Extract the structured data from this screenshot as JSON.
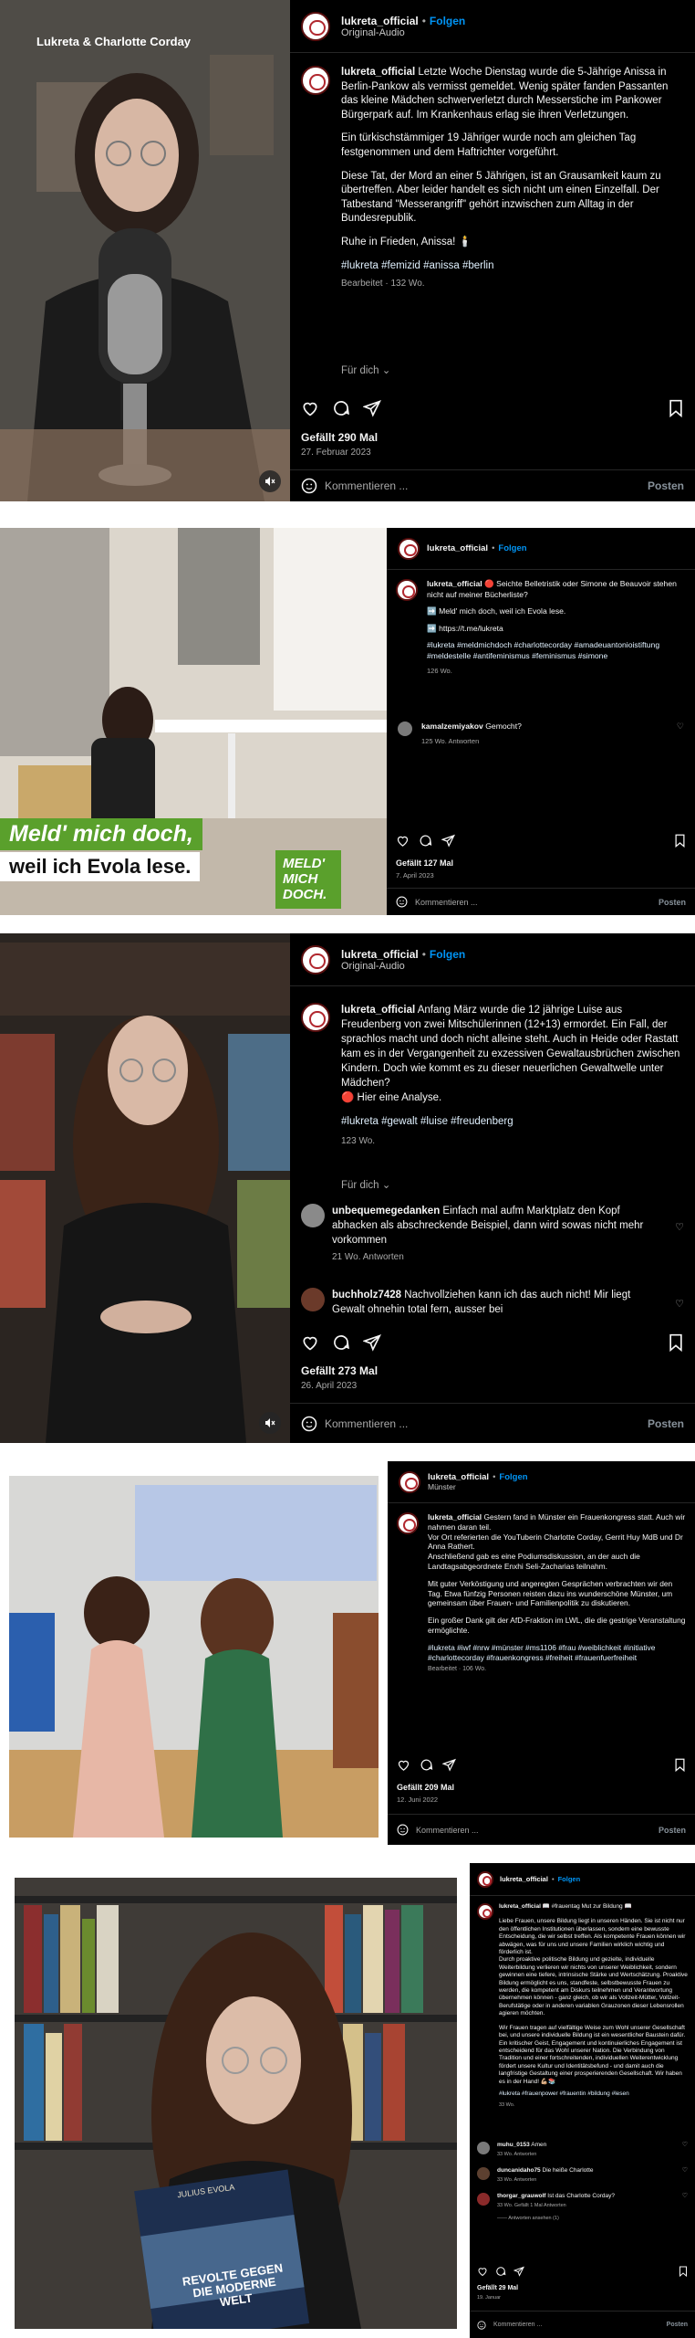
{
  "icons": {
    "heart": "heart-icon",
    "comment": "comment-icon",
    "share": "share-icon",
    "save": "bookmark-icon",
    "emoji": "emoji-icon",
    "mute": "mute-icon"
  },
  "colors": {
    "accent": "#0095f6",
    "panel": "#000000",
    "hashtag": "#e0f1ff",
    "muted": "#a8a8a8",
    "green": "#5aa02c"
  },
  "posts": [
    {
      "username": "lukreta_official",
      "sep": "•",
      "follow": "Folgen",
      "subtitle": "Original-Audio",
      "media_overlay": "Lukreta & Charlotte Corday",
      "caption_user": "lukreta_official",
      "caption_p1": "Letzte Woche Dienstag wurde die 5-Jährige Anissa in Berlin-Pankow als vermisst gemeldet. Wenig später fanden Passanten das kleine Mädchen schwerverletzt durch Messerstiche im Pankower Bürgerpark auf. Im Krankenhaus erlag sie ihren Verletzungen.",
      "caption_p2": "Ein türkischstämmiger 19 Jähriger wurde noch am gleichen Tag festgenommen und dem Haftrichter vorgeführt.",
      "caption_p3": "Diese Tat, der Mord an einer 5 Jährigen, ist an Grausamkeit kaum zu übertreffen. Aber leider handelt es sich nicht um einen Einzelfall. Der Tatbestand \"Messerangriff\" gehört inzwischen zum Alltag in der Bundesrepublik.",
      "caption_p4": "Ruhe in Frieden, Anissa! 🕯️",
      "hashtags": "#lukreta #femizid #anissa #berlin",
      "edited": "Bearbeitet · 132 Wo.",
      "for_you": "Für dich ⌄",
      "likes": "Gefällt 290 Mal",
      "date": "27. Februar 2023",
      "comment_placeholder": "Kommentieren ...",
      "post_button": "Posten"
    },
    {
      "username": "lukreta_official",
      "sep": "•",
      "follow": "Folgen",
      "caption_user": "lukreta_official",
      "caption_text": "🔴 Seichte Belletristik oder Simone de Beauvoir stehen nicht auf meiner Bücherliste?",
      "line2": "➡️ Meld' mich doch, weil ich Evola lese.",
      "line3": "➡️ https://t.me/lukreta",
      "hashtags": "#lukreta #meldmichdoch #charlottecorday #amadeuantonioistiftung #meldestelle #antifeminismus #feminismus #simone",
      "time": "126 Wo.",
      "c1_user": "kamalzemiyakov",
      "c1_text": "Gemocht?",
      "c1_meta": "125 Wo.   Antworten",
      "banner1": "Meld' mich doch,",
      "banner2": "weil ich Evola lese.",
      "logo1": "MELD'",
      "logo2": "MICH",
      "logo3": "DOCH.",
      "likes": "Gefällt 127 Mal",
      "date": "7. April 2023",
      "comment_placeholder": "Kommentieren ...",
      "post_button": "Posten"
    },
    {
      "username": "lukreta_official",
      "sep": "•",
      "follow": "Folgen",
      "subtitle": "Original-Audio",
      "caption_user": "lukreta_official",
      "caption_text": "Anfang März wurde die 12 jährige Luise aus Freudenberg von zwei Mitschülerinnen (12+13) ermordet. Ein Fall, der sprachlos macht und doch nicht alleine steht. Auch in Heide oder Rastatt kam es in der Vergangenheit zu exzessiven Gewaltausbrüchen zwischen Kindern. Doch wie kommt es zu dieser neuerlichen Gewaltwelle unter Mädchen?",
      "caption_line": "🔴 Hier eine Analyse.",
      "hashtags": "#lukreta #gewalt #luise #freudenberg",
      "time": "123 Wo.",
      "for_you": "Für dich ⌄",
      "c1_user": "unbequemegedanken",
      "c1_text": "Einfach mal aufm Marktplatz den Kopf abhacken als abschreckende Beispiel, dann wird sowas nicht mehr vorkommen",
      "c1_meta": "21 Wo.   Antworten",
      "c2_user": "buchholz7428",
      "c2_text": "Nachvollziehen kann ich das auch nicht! Mir liegt Gewalt ohnehin total fern, ausser bei",
      "likes": "Gefällt 273 Mal",
      "date": "26. April 2023",
      "comment_placeholder": "Kommentieren ...",
      "post_button": "Posten"
    },
    {
      "username": "lukreta_official",
      "sep": "•",
      "follow": "Folgen",
      "subtitle": "Münster",
      "caption_user": "lukreta_official",
      "caption_p1": "Gestern fand in Münster ein Frauenkongress statt. Auch wir nahmen daran teil.",
      "caption_p2": "Vor Ort referierten die YouTuberin Charlotte Corday, Gerrit Huy MdB und Dr Anna Rathert.",
      "caption_p3": "Anschließend gab es eine Podiumsdiskussion, an der auch die Landtagsabgeordnete Enxhi Seli-Zacharias teilnahm.",
      "caption_p4": "Mit guter Verköstigung und angeregten Gesprächen verbrachten wir den Tag. Etwa fünfzig Personen reisten dazu ins wunderschöne Münster, um gemeinsam über Frauen- und Familienpolitik zu diskutieren.",
      "caption_p5": "Ein großer Dank gilt der AfD-Fraktion im LWL, die die gestrige Veranstaltung ermöglichte.",
      "hashtags": "#lukreta #iwf #nrw #münster #ms1106 #frau #weiblichkeit #initiative #charlottecorday #frauenkongress #freiheit #frauenfuerfreiheit",
      "edited": "Bearbeitet · 106 Wo.",
      "likes": "Gefällt 209 Mal",
      "date": "12. Juni 2022",
      "comment_placeholder": "Kommentieren ...",
      "post_button": "Posten"
    },
    {
      "username": "lukreta_official",
      "sep": "•",
      "follow": "Folgen",
      "caption_user": "lukreta_official",
      "caption_head": "📖 #frauentag Mut zur Bildung 📖",
      "caption_p1": "Liebe Frauen, unsere Bildung liegt in unseren Händen. Sie ist nicht nur den öffentlichen Institutionen überlassen, sondern eine bewusste Entscheidung, die wir selbst treffen. Als kompetente Frauen können wir abwägen, was für uns und unsere Familien wirklich wichtig und förderlich ist.",
      "caption_p2": "Durch proaktive politische Bildung und gezielte, individuelle Weiterbildung verlieren wir nichts von unserer Weiblichkeit, sondern gewinnen eine tiefere, intrinsische Stärke und Wertschätzung. Proaktive Bildung ermöglicht es uns, standfeste, selbstbewusste Frauen zu werden, die kompetent am Diskurs teilnehmen und Verantwortung übernehmen können - ganz gleich, ob wir als Vollzeit-Mütter, Vollzeit-Berufstätige oder in anderen variablen Grauzonen dieser Lebensrollen agieren möchten.",
      "caption_p3": "Wir Frauen tragen auf vielfältige Weise zum Wohl unserer Gesellschaft bei, und unsere individuelle Bildung ist ein wesentlicher Baustein dafür. Ein kritischer Geist, Engagement und kontinuierliches Engagement ist entscheidend für das Wohl unserer Nation. Die Verbindung von Tradition und einer fortschreitenden, individuellen Weiterentwicklung fördert unsere Kultur und Identitätsbefund - und damit auch die langfristige Gestaltung einer prosperierenden Gesellschaft. Wir haben es in der Hand! 💪🏼📚",
      "hashtags": "#lukreta #frauenpower #frauentin #bildung #lesen",
      "time": "33 Wo.",
      "c1_user": "muhu_0153",
      "c1_text": "Amen",
      "c1_meta": "33 Wo.   Antworten",
      "c2_user": "duncanidaho75",
      "c2_text": "Die heiße Charlotte",
      "c2_meta": "33 Wo.   Antworten",
      "c3_user": "thorgar_grauwolf",
      "c3_text": "Ist das Charlotte Corday?",
      "c3_meta": "33 Wo.   Gefällt 1 Mal   Antworten",
      "c3_replies": "——  Antworten ansehen (1)",
      "book_top": "JULIUS EVOLA",
      "book_title": "REVOLTE GEGEN DIE MODERNE WELT",
      "likes": "Gefällt 29 Mal",
      "date": "19. Januar",
      "comment_placeholder": "Kommentieren ...",
      "post_button": "Posten"
    }
  ]
}
